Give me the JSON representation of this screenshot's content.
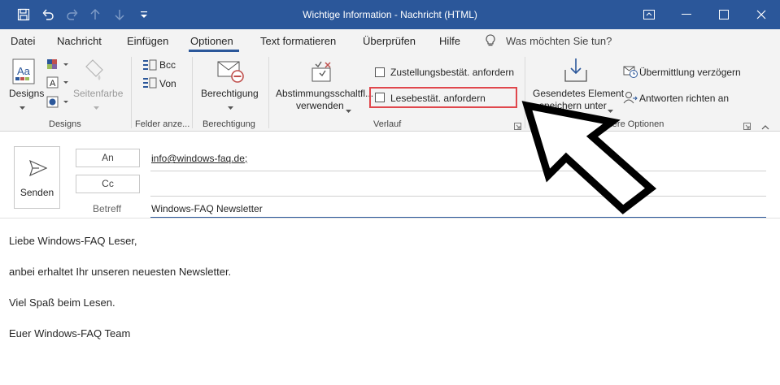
{
  "window": {
    "title": "Wichtige Information  -  Nachricht (HTML)"
  },
  "quick_access": {
    "icons": [
      "save-icon",
      "undo-icon",
      "redo-icon",
      "up-arrow-icon",
      "down-arrow-icon",
      "customize-icon"
    ]
  },
  "tabs": [
    {
      "label": "Datei"
    },
    {
      "label": "Nachricht"
    },
    {
      "label": "Einfügen"
    },
    {
      "label": "Optionen"
    },
    {
      "label": "Text formatieren"
    },
    {
      "label": "Überprüfen"
    },
    {
      "label": "Hilfe"
    }
  ],
  "active_tab": "Optionen",
  "tell_me": {
    "placeholder": "Was möchten Sie tun?"
  },
  "ribbon": {
    "designs": {
      "designs_label": "Designs",
      "seitenfarbe_label": "Seitenfarbe",
      "group_label": "Designs"
    },
    "felder": {
      "bcc_label": "Bcc",
      "von_label": "Von",
      "group_label": "Felder anze..."
    },
    "berechtigung": {
      "button_label": "Berechtigung",
      "group_label": "Berechtigung"
    },
    "verlauf": {
      "abstimmung_line1": "Abstimmungsschaltfl...",
      "abstimmung_line2": "verwenden",
      "zustellung_label": "Zustellungsbestät. anfordern",
      "lesebestaetigung_label": "Lesebestät. anfordern",
      "group_label": "Verlauf"
    },
    "weitere": {
      "gesendet_line1": "Gesendetes Element",
      "gesendet_line2": "speichern unter",
      "verzoegern_label": "Übermittlung verzögern",
      "antworten_label": "Antworten richten an",
      "group_label": "Weitere Optionen"
    }
  },
  "compose": {
    "send_label": "Senden",
    "to_button": "An",
    "cc_button": "Cc",
    "subject_label": "Betreff",
    "to_value": "info@windows-faq.de;",
    "cc_value": "",
    "subject_value": "Windows-FAQ Newsletter"
  },
  "body_lines": [
    "Liebe Windows-FAQ Leser,",
    "anbei erhaltet Ihr unseren neuesten Newsletter.",
    "Viel Spaß beim Lesen.",
    "Euer Windows-FAQ Team"
  ],
  "colors": {
    "titlebar": "#2b579a",
    "highlight": "#e0474c"
  }
}
